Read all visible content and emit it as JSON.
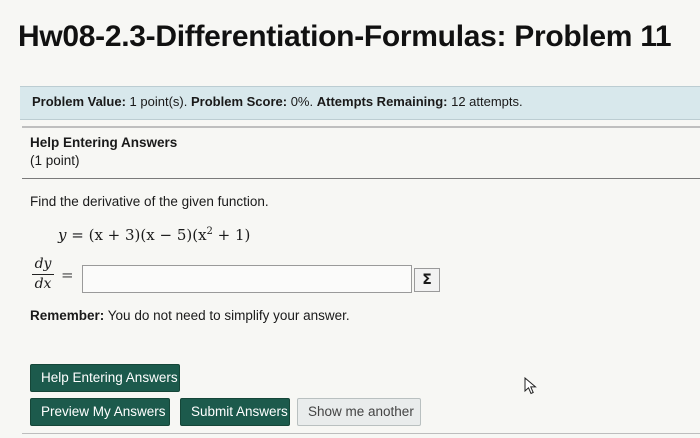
{
  "page": {
    "title": "Hw08-2.3-Differentiation-Formulas: Problem 11"
  },
  "info_bar": {
    "value_label": "Problem Value:",
    "value_text": "1 point(s).",
    "score_label": "Problem Score:",
    "score_text": "0%.",
    "attempts_label": "Attempts Remaining:",
    "attempts_text": "12 attempts."
  },
  "help_section": {
    "heading": "Help Entering Answers",
    "points": "(1 point)"
  },
  "problem": {
    "prompt": "Find the derivative of the given function.",
    "equation": {
      "lhs": "y",
      "eq": " = ",
      "part1": "(x + 3)(x − 5)(x",
      "exponent": "2",
      "part2": " + 1)"
    },
    "derivative": {
      "numerator": "dy",
      "denominator": "dx",
      "equals": "="
    },
    "answer": {
      "value": "",
      "placeholder": ""
    },
    "equation_editor_symbol": "Σ"
  },
  "remember": {
    "label": "Remember:",
    "text": " You do not need to simplify your answer."
  },
  "buttons": {
    "help": "Help Entering Answers",
    "preview": "Preview My Answers",
    "submit": "Submit Answers",
    "show_another": "Show me another"
  },
  "icons": {
    "cursor": "mouse-pointer-icon"
  },
  "colors": {
    "primary_button": "#1c5a4c",
    "info_bar": "#d8e8ec"
  }
}
